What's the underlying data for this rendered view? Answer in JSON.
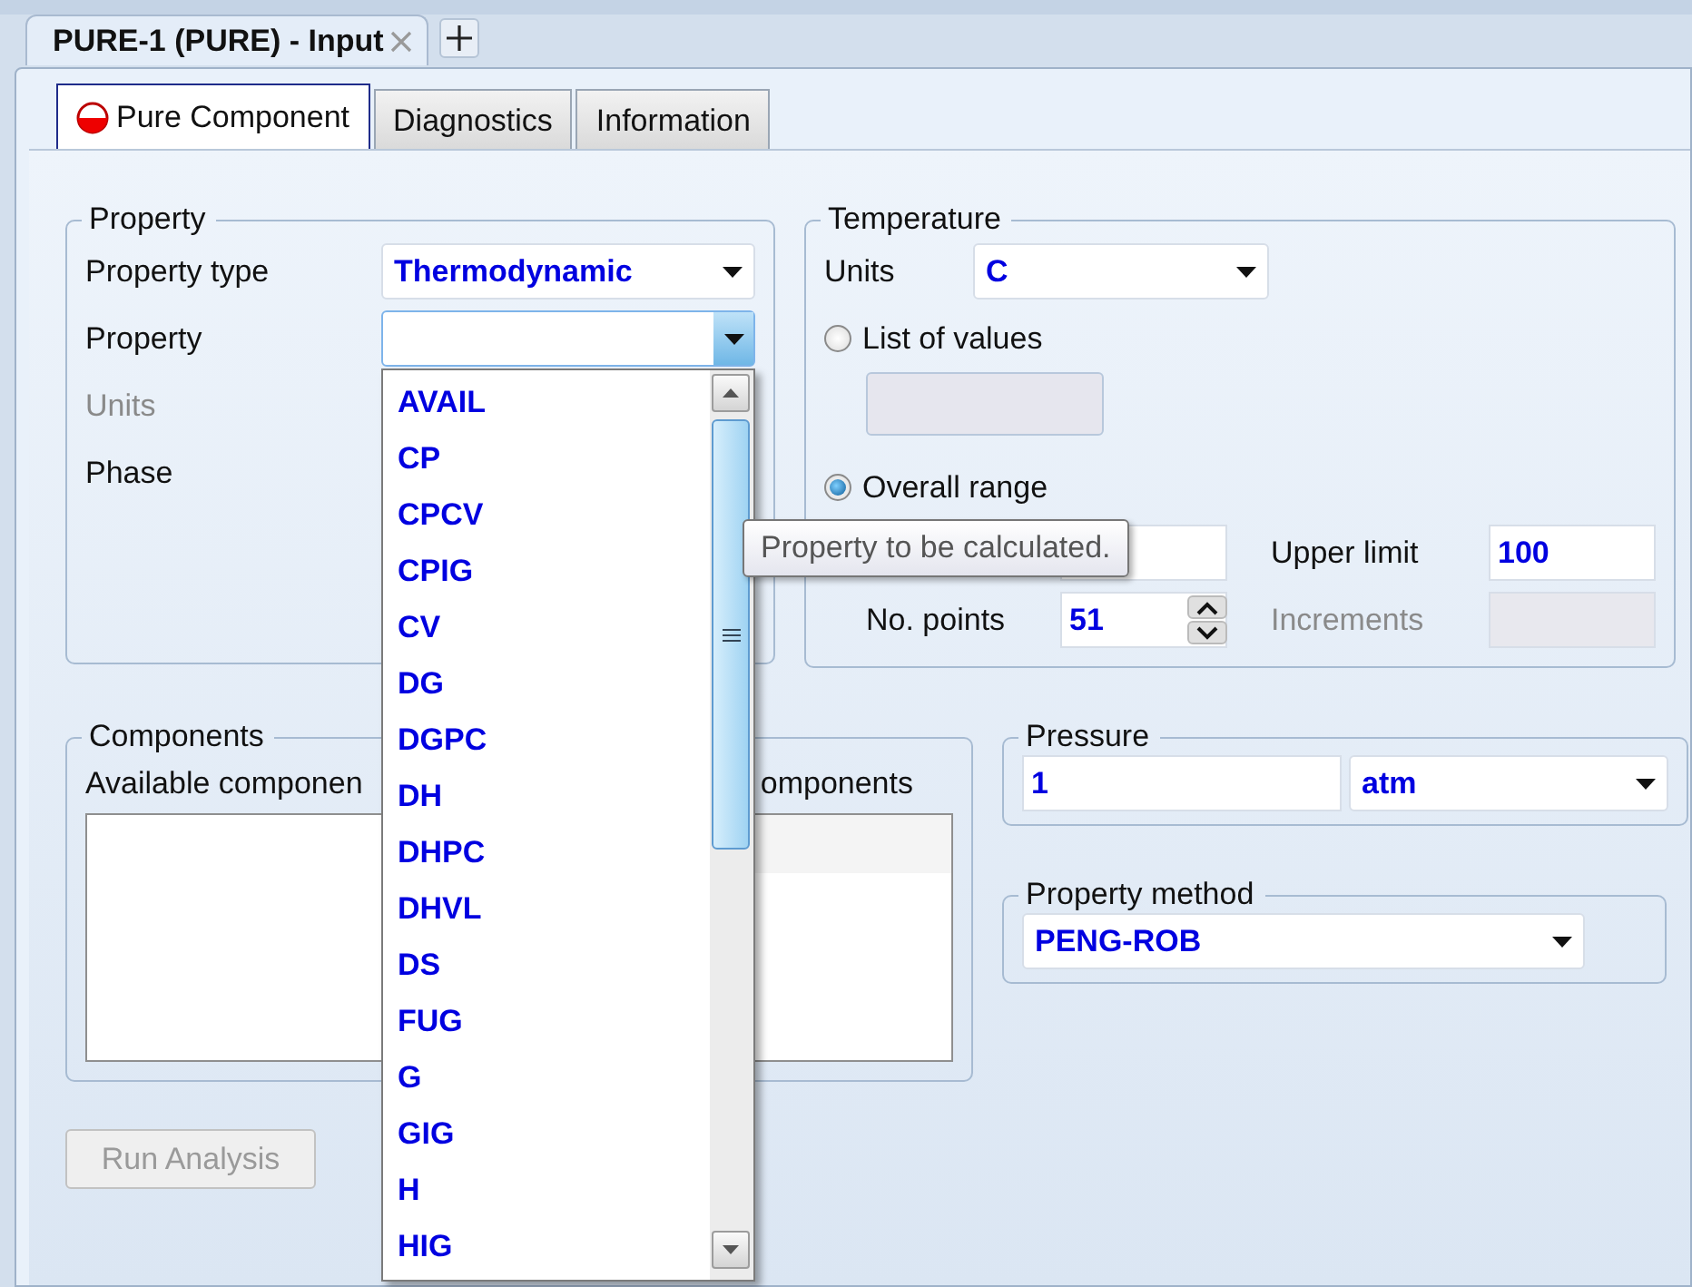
{
  "document_tab": {
    "title": "PURE-1 (PURE) - Input"
  },
  "tabs": [
    {
      "label": "Pure Component",
      "selected": true,
      "incomplete": true
    },
    {
      "label": "Diagnostics",
      "selected": false,
      "incomplete": false
    },
    {
      "label": "Information",
      "selected": false,
      "incomplete": false
    }
  ],
  "property": {
    "title": "Property",
    "type_label": "Property type",
    "type_value": "Thermodynamic",
    "property_label": "Property",
    "units_label": "Units",
    "units_disabled": true,
    "phase_label": "Phase"
  },
  "temperature": {
    "title": "Temperature",
    "units_label": "Units",
    "units_value": "C",
    "options": [
      {
        "label": "List of values",
        "selected": false
      },
      {
        "label": "Overall range",
        "selected": true
      }
    ],
    "upper_label": "Upper limit",
    "upper_value": "100",
    "points_label": "No. points",
    "points_value": "51",
    "increments_label": "Increments",
    "increments_disabled": true
  },
  "components": {
    "title": "Components",
    "available_label": "Available componen",
    "selected_label": "omponents"
  },
  "pressure": {
    "title": "Pressure",
    "value": "1",
    "units": "atm"
  },
  "property_method": {
    "title": "Property method",
    "value": "PENG-ROB"
  },
  "run_button": {
    "label": "Run Analysis",
    "disabled": true
  },
  "dropdown": {
    "items": [
      "AVAIL",
      "CP",
      "CPCV",
      "CPIG",
      "CV",
      "DG",
      "DGPC",
      "DH",
      "DHPC",
      "DHVL",
      "DS",
      "FUG",
      "G",
      "GIG",
      "H",
      "HIG"
    ]
  },
  "tooltip": {
    "text": "Property to be calculated."
  }
}
